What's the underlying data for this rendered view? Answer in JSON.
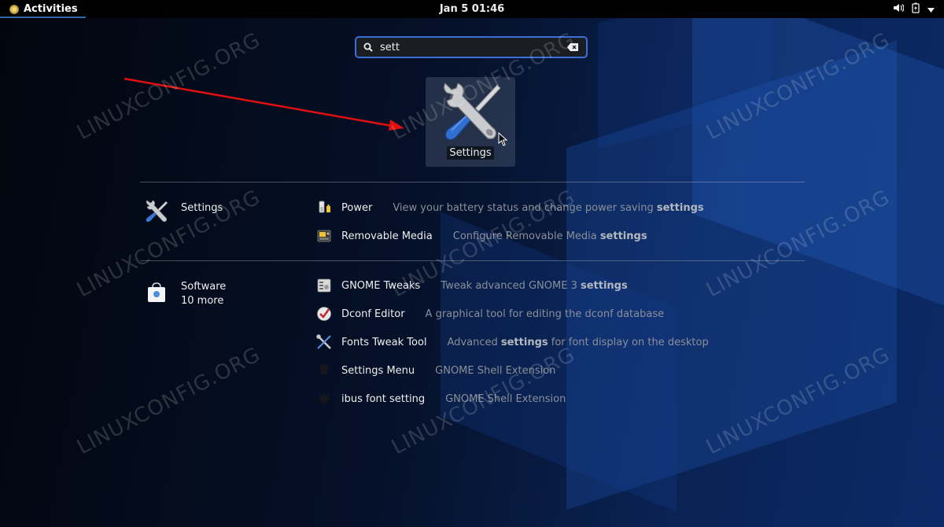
{
  "topbar": {
    "activities_label": "Activities",
    "clock": "Jan 5  01:46"
  },
  "search": {
    "value": "sett"
  },
  "main_result": {
    "label": "Settings"
  },
  "providers": [
    {
      "title": "Settings",
      "subtitle": "",
      "results": [
        {
          "name": "Power",
          "desc_parts": [
            "View your battery status and change power saving ",
            "settings",
            ""
          ]
        },
        {
          "name": "Removable Media",
          "desc_parts": [
            "Configure Removable Media ",
            "settings",
            ""
          ]
        }
      ]
    },
    {
      "title": "Software",
      "subtitle": "10 more",
      "results": [
        {
          "name": "GNOME Tweaks",
          "desc_parts": [
            "Tweak advanced GNOME 3 ",
            "settings",
            ""
          ]
        },
        {
          "name": "Dconf Editor",
          "desc_parts": [
            "A graphical tool for editing the dconf database",
            "",
            ""
          ]
        },
        {
          "name": "Fonts Tweak Tool",
          "desc_parts": [
            "Advanced ",
            "settings",
            " for font display on the desktop"
          ]
        },
        {
          "name": "Settings Menu",
          "desc_parts": [
            "GNOME Shell Extension",
            "",
            ""
          ]
        },
        {
          "name": "ibus font setting",
          "desc_parts": [
            "GNOME Shell Extension",
            "",
            ""
          ]
        }
      ]
    }
  ],
  "watermark": "LINUXCONFIG.ORG",
  "colors": {
    "accent": "#3c6fd6",
    "arrow": "#e01010",
    "topbar": "#000000"
  },
  "icons": [
    "search-icon",
    "clear-icon",
    "settings-icon",
    "power-icon",
    "removable-media-icon",
    "software-icon",
    "gnome-tweaks-icon",
    "dconf-editor-icon",
    "fonts-tweak-tool-icon",
    "settings-menu-icon",
    "ibus-font-setting-icon",
    "volume-icon",
    "battery-icon",
    "system-menu-icon"
  ]
}
